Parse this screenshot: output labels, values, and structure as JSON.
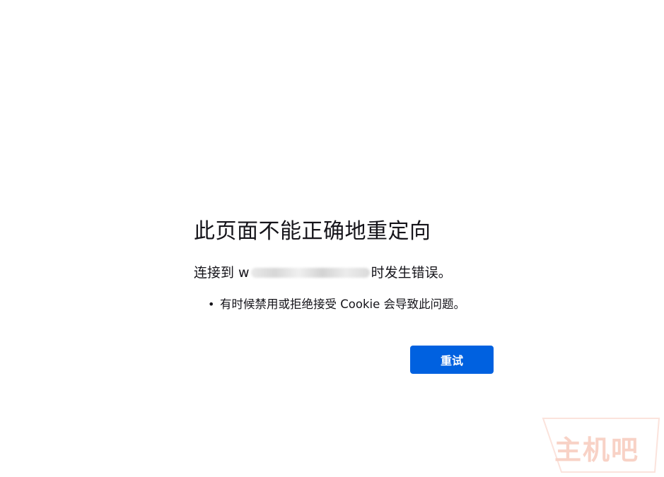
{
  "error_page": {
    "title": "此页面不能正确地重定向",
    "intro_prefix": "连接到 w",
    "intro_suffix": "时发生错误。",
    "details": [
      "有时候禁用或拒绝接受 Cookie 会导致此问题。"
    ],
    "bullet": "•",
    "retry_label": "重试"
  },
  "watermark": {
    "text": "主机吧"
  },
  "colors": {
    "accent": "#0061e0",
    "text": "#15141a",
    "watermark": "#f8d2c6"
  }
}
